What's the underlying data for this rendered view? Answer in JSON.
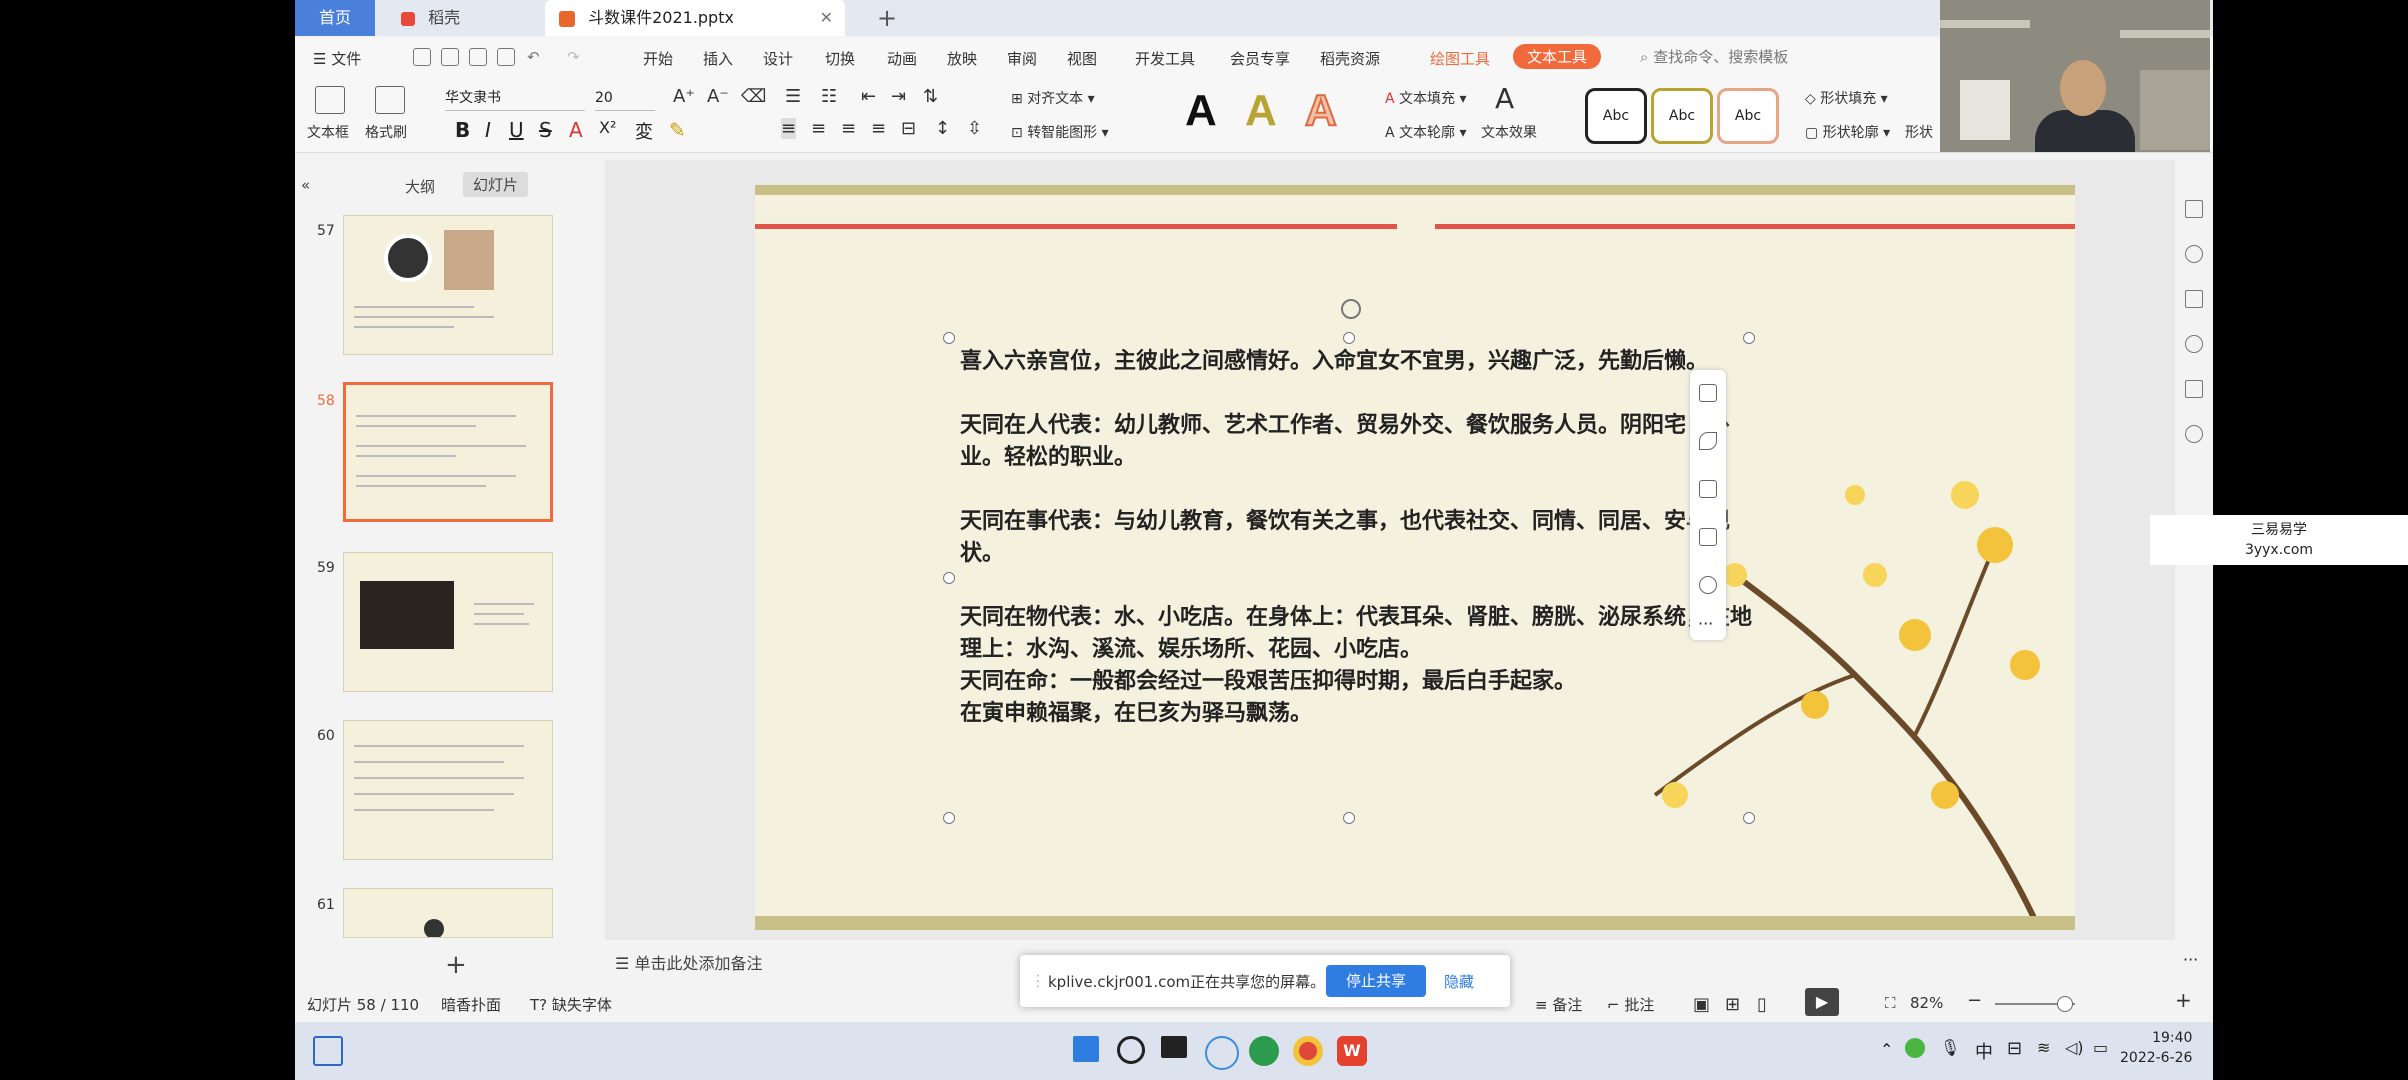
{
  "tabs": {
    "home": "首页",
    "daoke": "稻壳",
    "doc": "斗数课件2021.pptx"
  },
  "menu": {
    "file": "文件",
    "items": [
      "开始",
      "插入",
      "设计",
      "切换",
      "动画",
      "放映",
      "审阅",
      "视图",
      "开发工具",
      "会员专享",
      "稻壳资源"
    ],
    "drawing_tools": "绘图工具",
    "text_tools": "文本工具",
    "search_placeholder": "查找命令、搜索模板"
  },
  "ribbon": {
    "textbox": "文本框",
    "format_painter": "格式刷",
    "font": "华文隶书",
    "size": "20",
    "align_text": "对齐文本",
    "smart_graphic": "转智能图形",
    "text_fill": "文本填充",
    "text_outline": "文本轮廓",
    "text_effect": "文本效果",
    "style_abc": "Abc",
    "shape_fill": "形状填充",
    "shape_outline": "形状轮廓",
    "shape_more": "形状"
  },
  "left_panel": {
    "tab_outline": "大纲",
    "tab_slides": "幻灯片",
    "slides": [
      "57",
      "58",
      "59",
      "60",
      "61"
    ]
  },
  "slide_text": {
    "p1": "喜入六亲宫位，主彼此之间感情好。入命宜女不宜男，兴趣广泛，先勤后懒。",
    "p2": "天同在人代表：幼儿教师、艺术工作者、贸易外交、餐饮服务人员。阴阳宅卜卦业。轻松的职业。",
    "p3": "天同在事代表：与幼儿教育，餐饮有关之事，也代表社交、同情、同居、安与现状。",
    "p4": "天同在物代表：水、小吃店。在身体上：代表耳朵、肾脏、膀胱、泌尿系统，在地理上：水沟、溪流、娱乐场所、花园、小吃店。",
    "p5": "天同在命：一般都会经过一段艰苦压抑得时期，最后白手起家。",
    "p6": "在寅申赖福聚，在巳亥为驿马飘荡。"
  },
  "notes_placeholder": "单击此处添加备注",
  "status": {
    "slide_pos": "幻灯片 58 / 110",
    "theme": "暗香扑面",
    "missing_font": "缺失字体",
    "notes": "备注",
    "comments": "批注",
    "zoom": "82%"
  },
  "share": {
    "message": "kplive.ckjr001.com正在共享您的屏幕。",
    "stop": "停止共享",
    "hide": "隐藏"
  },
  "clock": {
    "time": "19:40",
    "date": "2022-6-26"
  },
  "tray": {
    "ime": "中"
  },
  "watermark": {
    "line1": "三易易学",
    "line2": "3yyx.com"
  },
  "colors": {
    "accent": "#f06a3c",
    "home_tab": "#4a7fdc",
    "slide_bg": "#f4f1df",
    "slide_red_line": "#e2554a",
    "share_button": "#2f7de1"
  }
}
